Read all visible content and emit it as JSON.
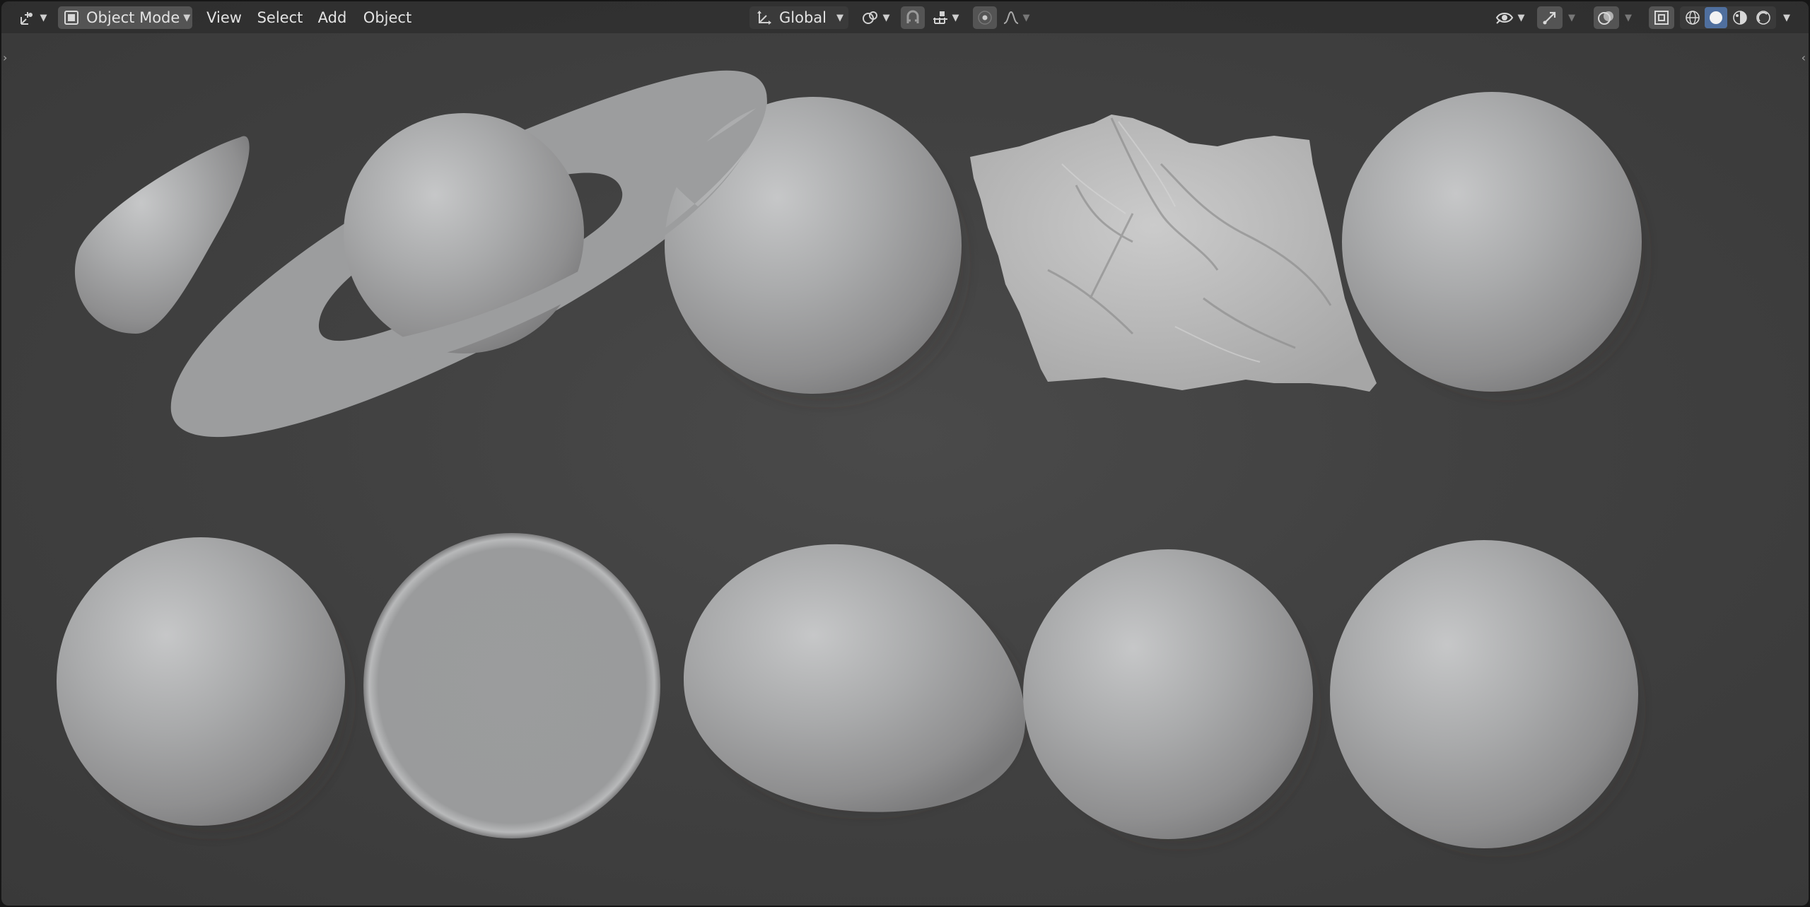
{
  "header": {
    "editor_type_icon": "editor-type-3d-viewport-icon",
    "mode": {
      "label": "Object Mode",
      "icon": "object-mode-icon"
    },
    "menus": [
      "View",
      "Select",
      "Add",
      "Object"
    ],
    "transform_orientation": {
      "label": "Global",
      "icon": "transform-orientation-icon"
    },
    "pivot_icon": "pivot-point-icon",
    "snap_icon": "snap-magnet-icon",
    "snap_increment_icon": "snap-increment-icon",
    "proportional_icon": "proportional-editing-icon",
    "falloff_icon": "falloff-curve-icon",
    "visibility_icon": "object-visibility-eye-icon",
    "gizmo_icon": "gizmo-icon",
    "overlay_icon": "overlays-icon",
    "xray_icon": "xray-toggle-icon",
    "shading_modes": [
      "wireframe",
      "solid",
      "material-preview",
      "rendered"
    ],
    "active_shading": "solid"
  },
  "colors": {
    "viewport_bg": "#414141",
    "header_bg": "#2b2b2b",
    "active_blue": "#4f6f9e",
    "mesh_gray": "#a9a9a9"
  },
  "scene": {
    "objects": [
      "teardrop",
      "ringed-sphere",
      "sphere",
      "terrain-mesh",
      "sphere",
      "sphere",
      "flat-disc",
      "egg-blob",
      "sphere",
      "sphere"
    ]
  }
}
